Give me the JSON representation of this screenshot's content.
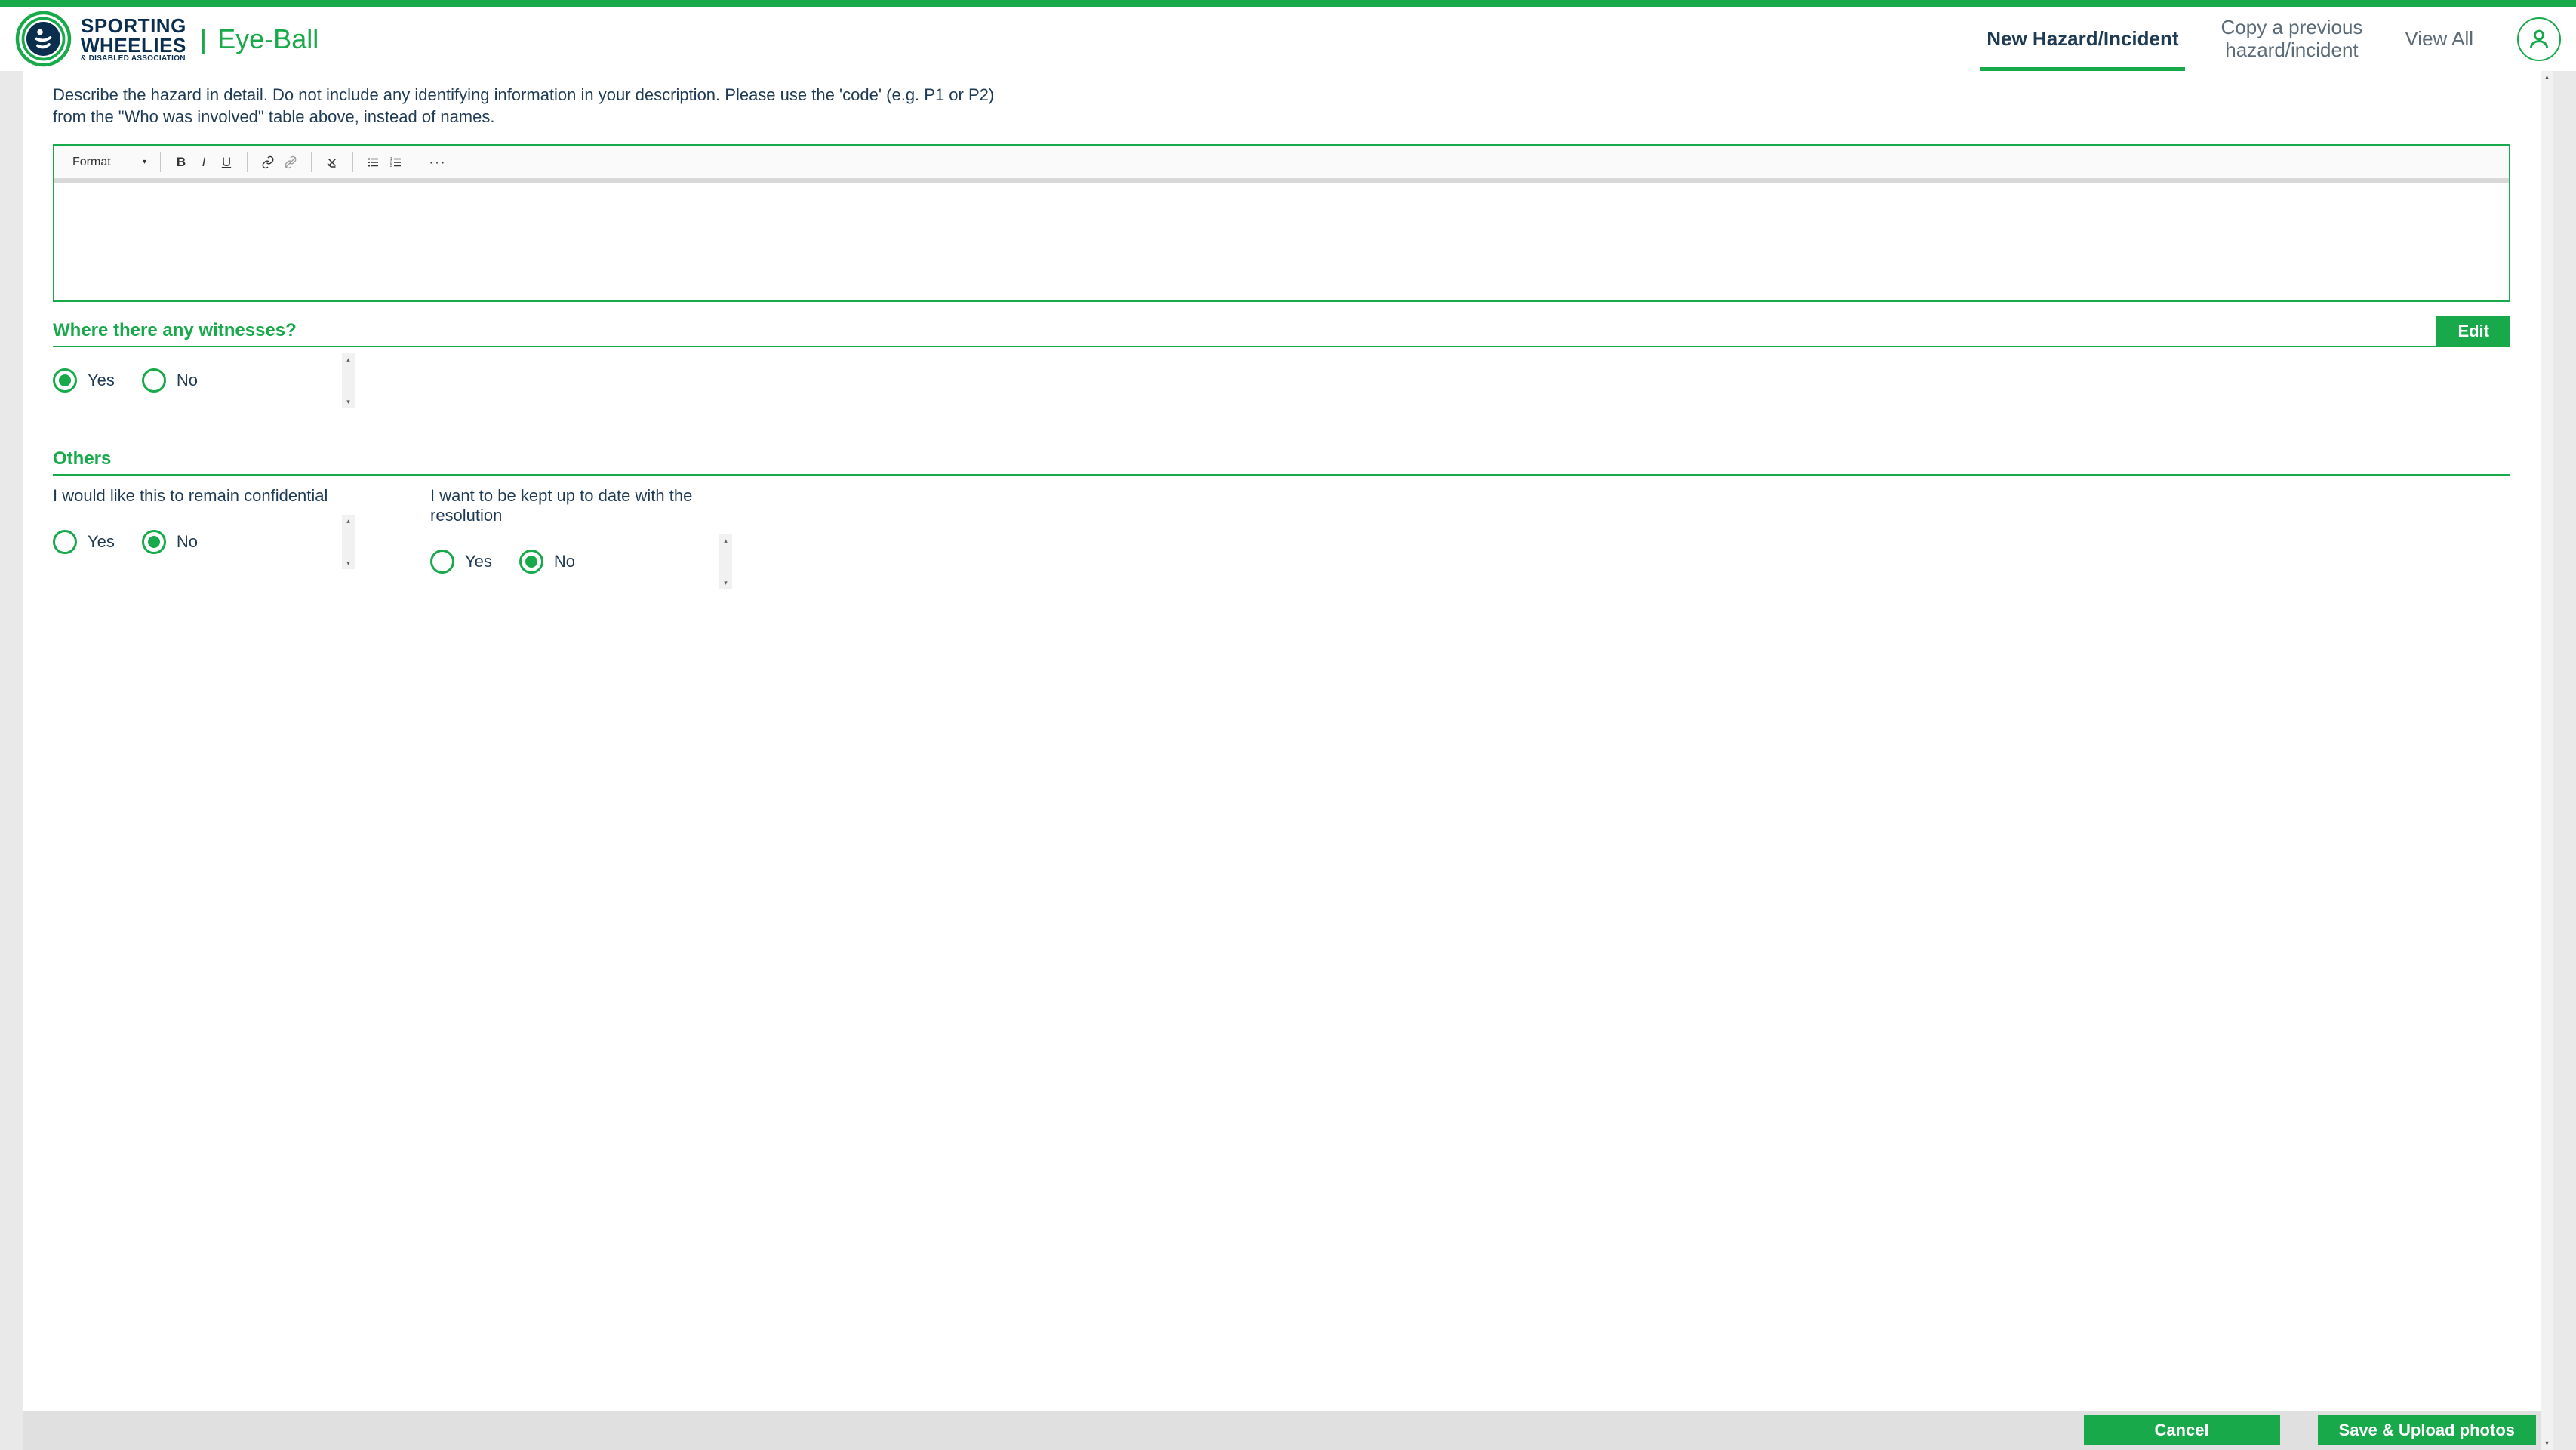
{
  "brand": {
    "line1": "SPORTING",
    "line2": "WHEELIES",
    "line3": "& DISABLED ASSOCIATION"
  },
  "app_title": "Eye-Ball",
  "tabs": {
    "new": "New Hazard/Incident",
    "copy_line1": "Copy a previous",
    "copy_line2": "hazard/incident",
    "view_all": "View All"
  },
  "instruction": "Describe the hazard in detail. Do not include any identifying information in your description. Please use the 'code' (e.g. P1 or P2) from the \"Who was involved\" table above, instead of names.",
  "rte": {
    "format_label": "Format"
  },
  "witnesses": {
    "title": "Where there any witnesses?",
    "edit": "Edit",
    "yes": "Yes",
    "no": "No",
    "selected": "yes"
  },
  "others": {
    "title": "Others",
    "confidential": {
      "question": "I would like this to remain confidential",
      "yes": "Yes",
      "no": "No",
      "selected": "no"
    },
    "resolution": {
      "question": "I want to be kept up to date with the resolution",
      "yes": "Yes",
      "no": "No",
      "selected": "no"
    }
  },
  "footer": {
    "cancel": "Cancel",
    "save": "Save & Upload photos"
  },
  "colors": {
    "accent": "#18a94b",
    "text": "#1f3b54"
  }
}
